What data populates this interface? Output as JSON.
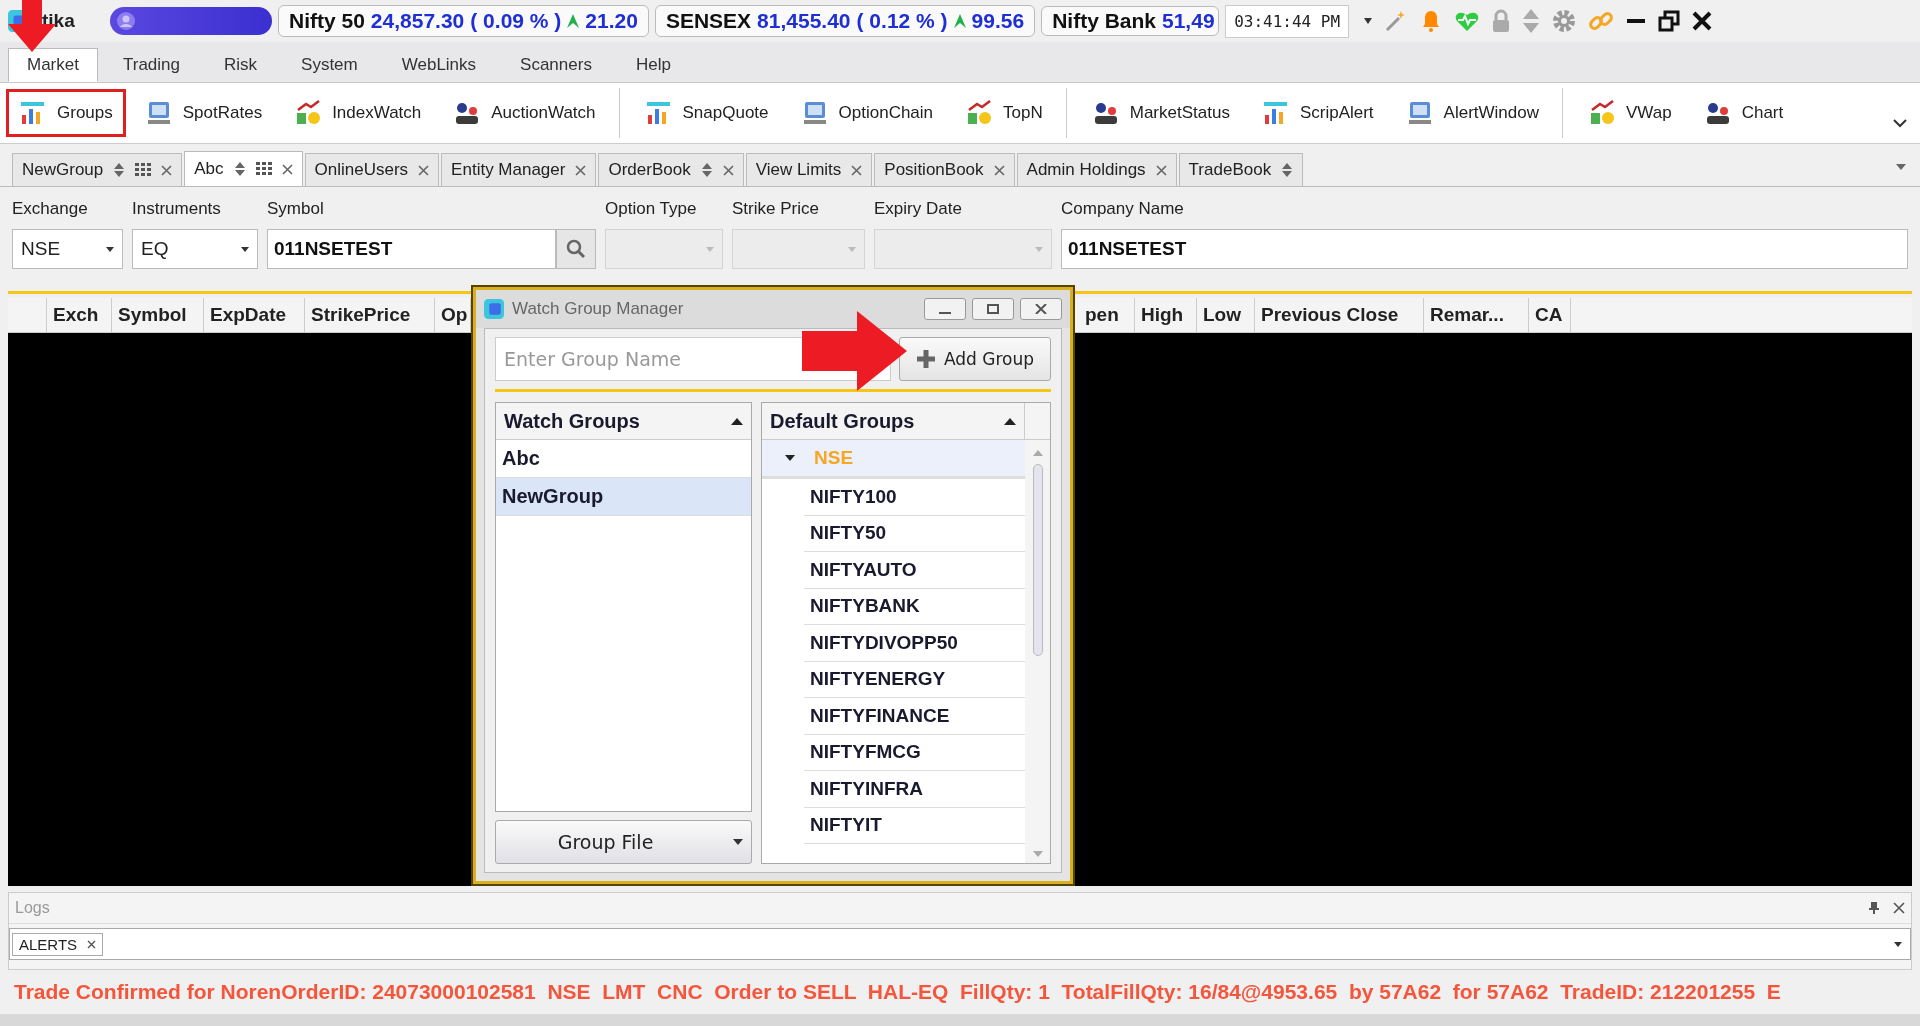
{
  "app": {
    "name": "tika"
  },
  "tickers": [
    {
      "name": "Nifty 50",
      "value": "24,857.30",
      "change_pct": "( 0.09 % )",
      "change": "21.20"
    },
    {
      "name": "SENSEX",
      "value": "81,455.40",
      "change_pct": "( 0.12 % )",
      "change": "99.56"
    },
    {
      "name": "Nifty Bank",
      "value": "51,49"
    }
  ],
  "clock": "03:41:44 PM",
  "menu": [
    {
      "label": "Market",
      "selected": true
    },
    {
      "label": "Trading",
      "selected": false
    },
    {
      "label": "Risk",
      "selected": false
    },
    {
      "label": "System",
      "selected": false
    },
    {
      "label": "WebLinks",
      "selected": false
    },
    {
      "label": "Scanners",
      "selected": false
    },
    {
      "label": "Help",
      "selected": false
    }
  ],
  "toolbar": [
    {
      "items": [
        {
          "label": "Groups",
          "highlighted": true
        },
        {
          "label": "SpotRates",
          "highlighted": false
        },
        {
          "label": "IndexWatch",
          "highlighted": false
        },
        {
          "label": "AuctionWatch",
          "highlighted": false
        }
      ]
    },
    {
      "items": [
        {
          "label": "SnapQuote",
          "highlighted": false
        },
        {
          "label": "OptionChain",
          "highlighted": false
        },
        {
          "label": "TopN",
          "highlighted": false
        }
      ]
    },
    {
      "items": [
        {
          "label": "MarketStatus",
          "highlighted": false
        },
        {
          "label": "ScripAlert",
          "highlighted": false
        },
        {
          "label": "AlertWindow",
          "highlighted": false
        }
      ]
    },
    {
      "items": [
        {
          "label": "VWap",
          "highlighted": false
        },
        {
          "label": "Chart",
          "highlighted": false
        }
      ]
    }
  ],
  "doc_tabs": [
    {
      "label": "NewGroup",
      "kind": "watch",
      "selected": false
    },
    {
      "label": "Abc",
      "kind": "watch",
      "selected": true
    },
    {
      "label": "OnlineUsers",
      "kind": "plain",
      "selected": false
    },
    {
      "label": "Entity Manager",
      "kind": "plain",
      "selected": false
    },
    {
      "label": "OrderBook",
      "kind": "sortable",
      "selected": false
    },
    {
      "label": "View Limits",
      "kind": "plain",
      "selected": false
    },
    {
      "label": "PositionBook",
      "kind": "plain",
      "selected": false
    },
    {
      "label": "Admin Holdings",
      "kind": "plain",
      "selected": false
    },
    {
      "label": "TradeBook",
      "kind": "sort-only",
      "selected": false
    }
  ],
  "form": [
    {
      "label": "Exchange",
      "kind": "select",
      "value": "NSE",
      "disabled": false
    },
    {
      "label": "Instruments",
      "kind": "select",
      "value": "EQ",
      "disabled": false
    },
    {
      "label": "Symbol",
      "kind": "search",
      "value": "011NSETEST",
      "disabled": false
    },
    {
      "label": "Option Type",
      "kind": "select",
      "disabled": true
    },
    {
      "label": "Strike Price",
      "kind": "select",
      "disabled": true
    },
    {
      "label": "Expiry Date",
      "kind": "select",
      "disabled": true
    },
    {
      "label": "Company Name",
      "kind": "input",
      "value": "011NSETEST",
      "disabled": false
    }
  ],
  "grid": {
    "columns": [
      "Exch",
      "Symbol",
      "ExpDate",
      "StrikePrice",
      "Op",
      "pen",
      "High",
      "Low",
      "Previous Close",
      "Remar...",
      "CA"
    ]
  },
  "dialog": {
    "title": "Watch Group Manager",
    "name_field": {
      "placeholder": "Enter Group Name"
    },
    "add_button": "Add Group",
    "watch_groups": {
      "header": "Watch Groups",
      "items": [
        {
          "label": "Abc",
          "selected": false
        },
        {
          "label": "NewGroup",
          "selected": true
        }
      ]
    },
    "group_file_button": "Group File",
    "default_groups": {
      "header": "Default Groups",
      "tree": [
        {
          "label": "NSE",
          "expanded": true,
          "children": [
            {
              "label": "NIFTY100"
            },
            {
              "label": "NIFTY50"
            },
            {
              "label": "NIFTYAUTO"
            },
            {
              "label": "NIFTYBANK"
            },
            {
              "label": "NIFTYDIVOPP50"
            },
            {
              "label": "NIFTYENERGY"
            },
            {
              "label": "NIFTYFINANCE"
            },
            {
              "label": "NIFTYFMCG"
            },
            {
              "label": "NIFTYINFRA"
            },
            {
              "label": "NIFTYIT"
            }
          ]
        }
      ]
    }
  },
  "logs": {
    "title": "Logs",
    "tabs": [
      {
        "label": "ALERTS"
      }
    ]
  },
  "status_message": "Trade Confirmed for NorenOrderID: 24073000102581  NSE  LMT  CNC  Order to SELL  HAL-EQ  FillQty: 1  TotalFillQty: 16/84@4953.65  by 57A62  for 57A62  TradeID: 212201255  E"
}
